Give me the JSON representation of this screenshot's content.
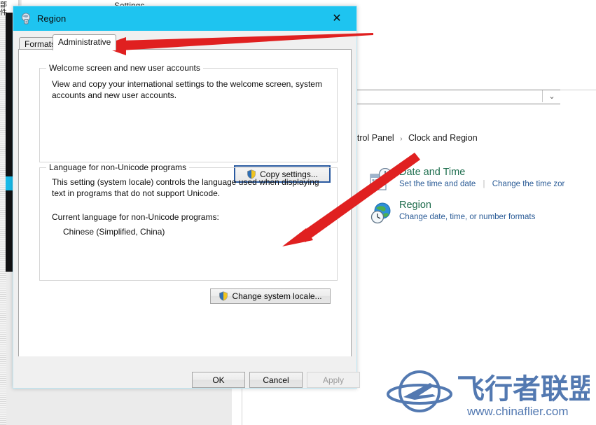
{
  "dialog": {
    "title": "Region",
    "icon": "region-globe-icon",
    "close_label": "✕",
    "tabs": [
      {
        "label": "Formats",
        "active": false
      },
      {
        "label": "Administrative",
        "active": true
      }
    ],
    "group_welcome": {
      "legend": "Welcome screen and new user accounts",
      "description": "View and copy your international settings to the welcome screen, system accounts and new user accounts.",
      "button": "Copy settings...",
      "button_icon": "uac-shield-icon",
      "button_focused": true
    },
    "group_nonunicode": {
      "legend": "Language for non-Unicode programs",
      "description": "This setting (system locale) controls the language used when displaying text in programs that do not support Unicode.",
      "current_label": "Current language for non-Unicode programs:",
      "current_value": "Chinese (Simplified, China)",
      "button": "Change system locale...",
      "button_icon": "uac-shield-icon"
    },
    "footer": {
      "ok": "OK",
      "cancel": "Cancel",
      "apply": "Apply",
      "apply_disabled": true
    }
  },
  "control_panel": {
    "breadcrumb": [
      "ontrol Panel",
      "Clock and Region"
    ],
    "breadcrumb_separator": "›",
    "items": [
      {
        "title": "Date and Time",
        "icon": "calendar-clock-icon",
        "links": [
          "Set the time and date",
          "Change the time zor"
        ]
      },
      {
        "title": "Region",
        "icon": "globe-clock-icon",
        "links": [
          "Change date, time, or number formats"
        ]
      }
    ],
    "search_box_value": "",
    "search_box_chevron": "⌄"
  },
  "background": {
    "settings_window_title": "Settings",
    "settings_back_icon": "back-arrow-icon",
    "left_strip_text": "部件"
  },
  "watermark": {
    "brand_cjk": "飞行者联盟",
    "url": "www.chinaflier.com",
    "logo_icon": "airplane-orbit-logo",
    "color": "#4a72ad"
  },
  "annotations": [
    {
      "name": "arrow-to-administrative-tab",
      "color": "#e02020"
    },
    {
      "name": "arrow-to-change-system-locale",
      "color": "#e02020"
    }
  ],
  "colors": {
    "titlebar": "#1ec4f0",
    "accent_blue": "#2a5aa0",
    "link_blue": "#2a5b96",
    "heading_green": "#1f6f4f",
    "arrow_red": "#e02020"
  }
}
